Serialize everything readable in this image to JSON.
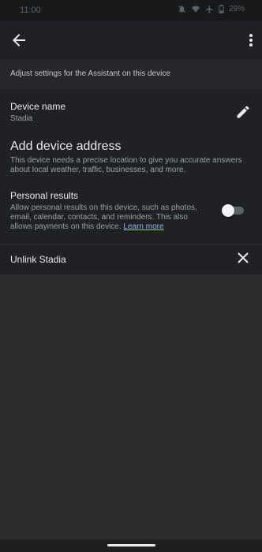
{
  "status_bar": {
    "time": "11:00",
    "battery": "29%",
    "icons": [
      "mute-icon",
      "wifi-icon",
      "airplane-icon",
      "battery-icon"
    ]
  },
  "app_bar": {
    "back_icon": "back-arrow-icon",
    "menu_icon": "more-vert-icon"
  },
  "intro": {
    "text": "Adjust settings for the Assistant on this device"
  },
  "device_name": {
    "title": "Device name",
    "value": "Stadia",
    "edit_icon": "pencil-icon"
  },
  "address": {
    "title": "Add device address",
    "description": "This device needs a precise location to give you accurate answers about local weather, traffic, businesses, and more."
  },
  "personal_results": {
    "title": "Personal results",
    "description": "Allow personal results on this device, such as photos, email, calendar, contacts, and reminders. This also allows payments on this device.",
    "learn_more": "Learn more",
    "enabled": false
  },
  "unlink": {
    "label": "Unlink Stadia",
    "icon": "close-icon"
  },
  "colors": {
    "background": "#202124",
    "empty_area": "#2c2c2e",
    "link": "#8ab4f8",
    "text_primary": "#e8eaed",
    "text_secondary": "#9aa0a6"
  }
}
